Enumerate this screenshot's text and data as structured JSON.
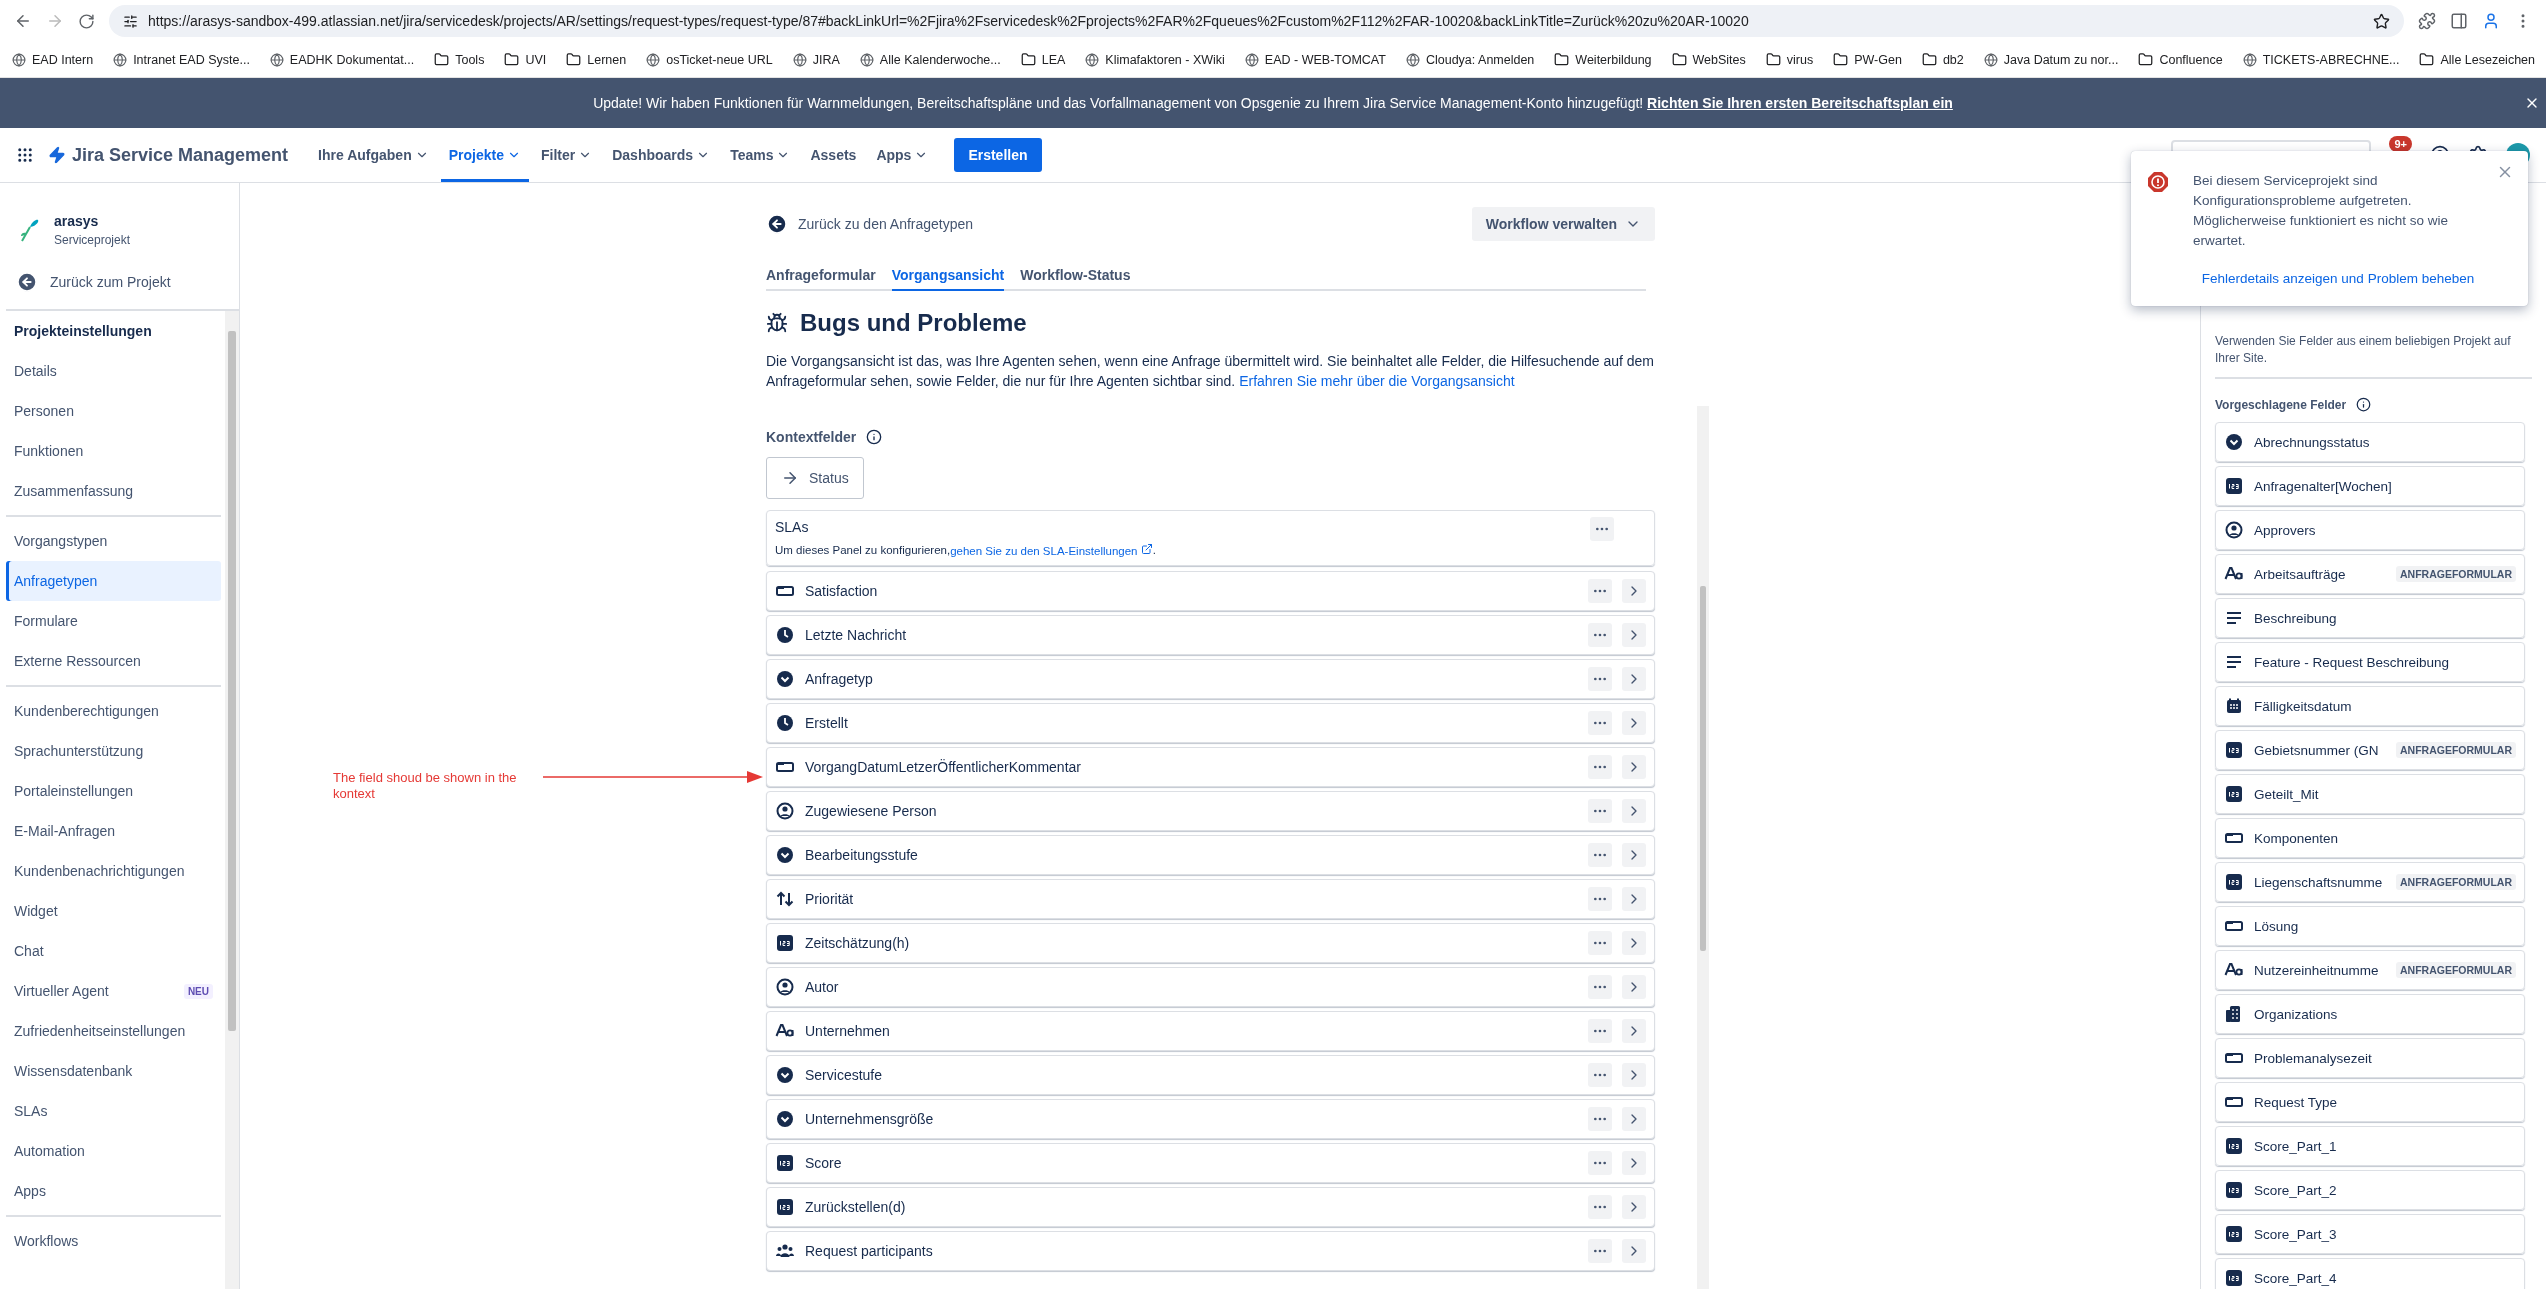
{
  "browser": {
    "url": "https://arasys-sandbox-499.atlassian.net/jira/servicedesk/projects/AR/settings/request-types/request-type/87#backLinkUrl=%2Fjira%2Fservicedesk%2Fprojects%2FAR%2Fqueues%2Fcustom%2F112%2FAR-10020&backLinkTitle=Zurück%20zu%20AR-10020",
    "bookmarks": [
      {
        "label": "EAD Intern",
        "kind": "site"
      },
      {
        "label": "Intranet EAD Syste...",
        "kind": "site"
      },
      {
        "label": "EADHK Dokumentat...",
        "kind": "site"
      },
      {
        "label": "Tools",
        "kind": "folder"
      },
      {
        "label": "UVI",
        "kind": "folder"
      },
      {
        "label": "Lernen",
        "kind": "folder"
      },
      {
        "label": "osTicket-neue URL",
        "kind": "site"
      },
      {
        "label": "JIRA",
        "kind": "site"
      },
      {
        "label": "Alle Kalenderwoche...",
        "kind": "site"
      },
      {
        "label": "LEA",
        "kind": "folder"
      },
      {
        "label": "Klimafaktoren - XWiki",
        "kind": "site"
      },
      {
        "label": "EAD - WEB-TOMCAT",
        "kind": "site"
      },
      {
        "label": "Cloudya: Anmelden",
        "kind": "site"
      },
      {
        "label": "Weiterbildung",
        "kind": "folder"
      },
      {
        "label": "WebSites",
        "kind": "folder"
      },
      {
        "label": "virus",
        "kind": "folder"
      },
      {
        "label": "PW-Gen",
        "kind": "folder"
      },
      {
        "label": "db2",
        "kind": "folder"
      },
      {
        "label": "Java Datum zu nor...",
        "kind": "site"
      },
      {
        "label": "Confluence",
        "kind": "folder"
      },
      {
        "label": "TICKETS-ABRECHNE...",
        "kind": "site"
      }
    ],
    "all_bookmarks": "Alle Lesezeichen"
  },
  "banner": {
    "text": "Update! Wir haben Funktionen für Warnmeldungen, Bereitschaftspläne und das Vorfallmanagement von Opsgenie zu Ihrem Jira Service Management-Konto hinzugefügt!",
    "link": "Richten Sie Ihren ersten Bereitschaftsplan ein"
  },
  "nav": {
    "product": "Jira Service Management",
    "items": [
      {
        "label": "Ihre Aufgaben",
        "dropdown": true,
        "selected": false
      },
      {
        "label": "Projekte",
        "dropdown": true,
        "selected": true
      },
      {
        "label": "Filter",
        "dropdown": true,
        "selected": false
      },
      {
        "label": "Dashboards",
        "dropdown": true,
        "selected": false
      },
      {
        "label": "Teams",
        "dropdown": true,
        "selected": false
      },
      {
        "label": "Assets",
        "dropdown": false,
        "selected": false
      },
      {
        "label": "Apps",
        "dropdown": true,
        "selected": false
      }
    ],
    "create_button": "Erstellen",
    "notification_count": "9+"
  },
  "sidebar": {
    "project_name": "arasys",
    "project_type": "Serviceprojekt",
    "back": "Zurück zum Projekt",
    "heading": "Projekteinstellungen",
    "groups": [
      {
        "items": [
          {
            "label": "Details",
            "selected": false
          },
          {
            "label": "Personen",
            "selected": false
          },
          {
            "label": "Funktionen",
            "selected": false
          },
          {
            "label": "Zusammenfassung",
            "selected": false
          }
        ]
      },
      {
        "items": [
          {
            "label": "Vorgangstypen",
            "selected": false
          },
          {
            "label": "Anfragetypen",
            "selected": true
          },
          {
            "label": "Formulare",
            "selected": false
          },
          {
            "label": "Externe Ressourcen",
            "selected": false
          }
        ]
      },
      {
        "items": [
          {
            "label": "Kundenberechtigungen",
            "selected": false
          },
          {
            "label": "Sprachunterstützung",
            "selected": false
          },
          {
            "label": "Portaleinstellungen",
            "selected": false
          },
          {
            "label": "E-Mail-Anfragen",
            "selected": false
          },
          {
            "label": "Kundenbenachrichtigungen",
            "selected": false
          },
          {
            "label": "Widget",
            "selected": false
          },
          {
            "label": "Chat",
            "selected": false
          },
          {
            "label": "Virtueller Agent",
            "selected": false,
            "badge": "NEU"
          },
          {
            "label": "Zufriedenheitseinstellungen",
            "selected": false
          },
          {
            "label": "Wissensdatenbank",
            "selected": false
          },
          {
            "label": "SLAs",
            "selected": false
          },
          {
            "label": "Automation",
            "selected": false
          },
          {
            "label": "Apps",
            "selected": false
          }
        ]
      },
      {
        "items": [
          {
            "label": "Workflows",
            "selected": false
          }
        ]
      }
    ]
  },
  "page": {
    "back": "Zurück zu den Anfragetypen",
    "workflow_button": "Workflow verwalten",
    "tabs": [
      {
        "label": "Anfrageformular",
        "selected": false
      },
      {
        "label": "Vorgangsansicht",
        "selected": true
      },
      {
        "label": "Workflow-Status",
        "selected": false
      }
    ],
    "title": "Bugs und Probleme",
    "description": "Die Vorgangsansicht ist das, was Ihre Agenten sehen, wenn eine Anfrage übermittelt wird. Sie beinhaltet alle Felder, die Hilfesuchende auf dem Anfrageformular sehen, sowie Felder, die nur für Ihre Agenten sichtbar sind.",
    "description_link": "Erfahren Sie mehr über die Vorgangsansicht",
    "context_heading": "Kontextfelder",
    "status_chip": "Status",
    "sla": {
      "title": "SLAs",
      "text": "Um dieses Panel zu konfigurieren,",
      "link": "gehen Sie zu den SLA-Einstellungen",
      "suffix": "."
    },
    "fields": [
      {
        "name": "Satisfaction",
        "kind": "text-box"
      },
      {
        "name": "Letzte Nachricht",
        "kind": "clock"
      },
      {
        "name": "Anfragetyp",
        "kind": "dropdown"
      },
      {
        "name": "Erstellt",
        "kind": "clock"
      },
      {
        "name": "VorgangDatumLetzerÖffentlicherKommentar",
        "kind": "text-box"
      },
      {
        "name": "Zugewiesene Person",
        "kind": "person"
      },
      {
        "name": "Bearbeitungsstufe",
        "kind": "dropdown"
      },
      {
        "name": "Priorität",
        "kind": "priority"
      },
      {
        "name": "Zeitschätzung(h)",
        "kind": "number"
      },
      {
        "name": "Autor",
        "kind": "person"
      },
      {
        "name": "Unternehmen",
        "kind": "text"
      },
      {
        "name": "Servicestufe",
        "kind": "dropdown"
      },
      {
        "name": "Unternehmensgröße",
        "kind": "dropdown"
      },
      {
        "name": "Score",
        "kind": "number"
      },
      {
        "name": "Zurückstellen(d)",
        "kind": "number"
      },
      {
        "name": "Request participants",
        "kind": "people"
      }
    ]
  },
  "annotation": {
    "text": "The field shoud be shown in the kontext"
  },
  "right_panel": {
    "hint": "Verwenden Sie Felder aus einem beliebigen Projekt auf Ihrer Site.",
    "heading": "Vorgeschlagene Felder",
    "fields": [
      {
        "name": "Abrechnungsstatus",
        "kind": "dropdown"
      },
      {
        "name": "Anfragenalter[Wochen]",
        "kind": "number"
      },
      {
        "name": "Approvers",
        "kind": "person"
      },
      {
        "name": "Arbeitsaufträge",
        "kind": "text",
        "tag": "ANFRAGEFORMULAR"
      },
      {
        "name": "Beschreibung",
        "kind": "paragraph"
      },
      {
        "name": "Feature - Request Beschreibung",
        "kind": "paragraph"
      },
      {
        "name": "Fälligkeitsdatum",
        "kind": "calendar"
      },
      {
        "name": "Gebietsnummer (GN",
        "kind": "number",
        "tag": "ANFRAGEFORMULAR"
      },
      {
        "name": "Geteilt_Mit",
        "kind": "number"
      },
      {
        "name": "Komponenten",
        "kind": "text-box"
      },
      {
        "name": "Liegenschaftsnumme",
        "kind": "number",
        "tag": "ANFRAGEFORMULAR"
      },
      {
        "name": "Lösung",
        "kind": "text-box"
      },
      {
        "name": "Nutzereinheitnumme",
        "kind": "text",
        "tag": "ANFRAGEFORMULAR"
      },
      {
        "name": "Organizations",
        "kind": "organization"
      },
      {
        "name": "Problemanalysezeit",
        "kind": "text-box"
      },
      {
        "name": "Request Type",
        "kind": "text-box"
      },
      {
        "name": "Score_Part_1",
        "kind": "number"
      },
      {
        "name": "Score_Part_2",
        "kind": "number"
      },
      {
        "name": "Score_Part_3",
        "kind": "number"
      },
      {
        "name": "Score_Part_4",
        "kind": "number"
      }
    ]
  },
  "alert": {
    "text": "Bei diesem Serviceprojekt sind Konfigurationsprobleme aufgetreten. Möglicherweise funktioniert es nicht so wie erwartet.",
    "link": "Fehlerdetails anzeigen und Problem beheben"
  }
}
